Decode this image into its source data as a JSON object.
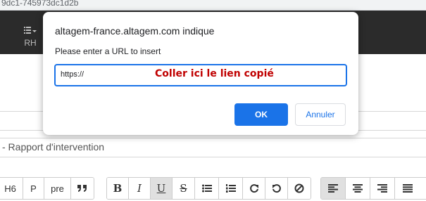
{
  "page": {
    "url_fragment": "9dc1-745973dc1d2b",
    "nav_item_label": "RH",
    "intervention_title": "- Rapport d'intervention"
  },
  "toolbar": {
    "heading_buttons": [
      "H6",
      "P",
      "pre"
    ],
    "quote_icon": "quote-icon",
    "format_labels": [
      "B",
      "I",
      "U",
      "S"
    ],
    "list_icons": [
      "bullet-list-icon",
      "numbered-list-icon",
      "redo-icon",
      "undo-icon",
      "clear-format-icon"
    ],
    "align_icons": [
      "align-left-icon",
      "align-center-icon",
      "align-right-icon",
      "align-justify-icon"
    ],
    "active_align": "align-left-icon"
  },
  "dialog": {
    "title": "altagem-france.altagem.com indique",
    "message": "Please enter a URL to insert",
    "input_value": "https://",
    "annotation": "Coller ici le lien copié",
    "ok_label": "OK",
    "cancel_label": "Annuler"
  },
  "colors": {
    "accent": "#1a73e8",
    "annotation": "#c00000",
    "navbar": "#2b2b2b"
  }
}
